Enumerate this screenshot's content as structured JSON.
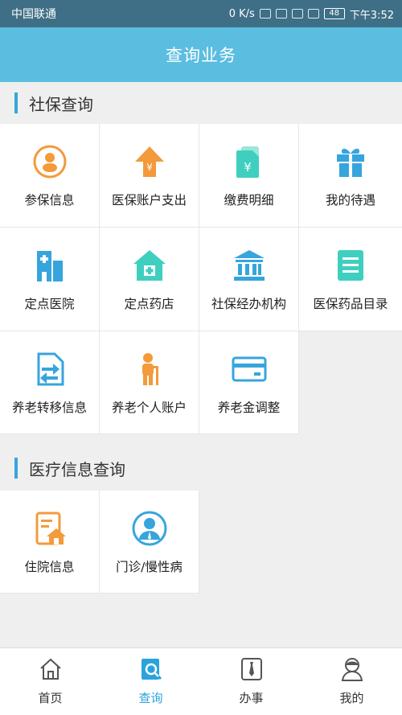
{
  "status_bar": {
    "carrier": "中国联通",
    "speed": "0 K/s",
    "battery": "48",
    "time": "下午3:52"
  },
  "header": {
    "title": "查询业务"
  },
  "sections": [
    {
      "title": "社保查询",
      "items": [
        {
          "label": "参保信息",
          "icon": "person-circle-icon",
          "color": "#f39a3b"
        },
        {
          "label": "医保账户支出",
          "icon": "yen-up-arrow-icon",
          "color": "#f39a3b"
        },
        {
          "label": "缴费明细",
          "icon": "yen-document-icon",
          "color": "#3fcfbf"
        },
        {
          "label": "我的待遇",
          "icon": "gift-icon",
          "color": "#36a5dd"
        },
        {
          "label": "定点医院",
          "icon": "hospital-icon",
          "color": "#36a5dd"
        },
        {
          "label": "定点药店",
          "icon": "pharmacy-house-icon",
          "color": "#3fcfbf"
        },
        {
          "label": "社保经办机构",
          "icon": "institution-building-icon",
          "color": "#36a5dd"
        },
        {
          "label": "医保药品目录",
          "icon": "list-document-icon",
          "color": "#3fcfbf"
        },
        {
          "label": "养老转移信息",
          "icon": "transfer-document-icon",
          "color": "#36a5dd"
        },
        {
          "label": "养老个人账户",
          "icon": "elderly-person-icon",
          "color": "#f39a3b"
        },
        {
          "label": "养老金调整",
          "icon": "bank-card-icon",
          "color": "#36a5dd"
        }
      ]
    },
    {
      "title": "医疗信息查询",
      "items": [
        {
          "label": "住院信息",
          "icon": "inpatient-document-icon",
          "color": "#f39a3b"
        },
        {
          "label": "门诊/慢性病",
          "icon": "doctor-avatar-icon",
          "color": "#36a5dd"
        }
      ]
    }
  ],
  "bottom_nav": [
    {
      "label": "首页",
      "icon": "home-icon",
      "active": false
    },
    {
      "label": "查询",
      "icon": "search-document-icon",
      "active": true
    },
    {
      "label": "办事",
      "icon": "tie-icon",
      "active": false
    },
    {
      "label": "我的",
      "icon": "user-icon",
      "active": false
    }
  ],
  "colors": {
    "header_bg": "#5bbde0",
    "status_bg": "#3e6f86",
    "accent": "#36a5dd",
    "orange": "#f39a3b",
    "teal": "#3fcfbf"
  }
}
